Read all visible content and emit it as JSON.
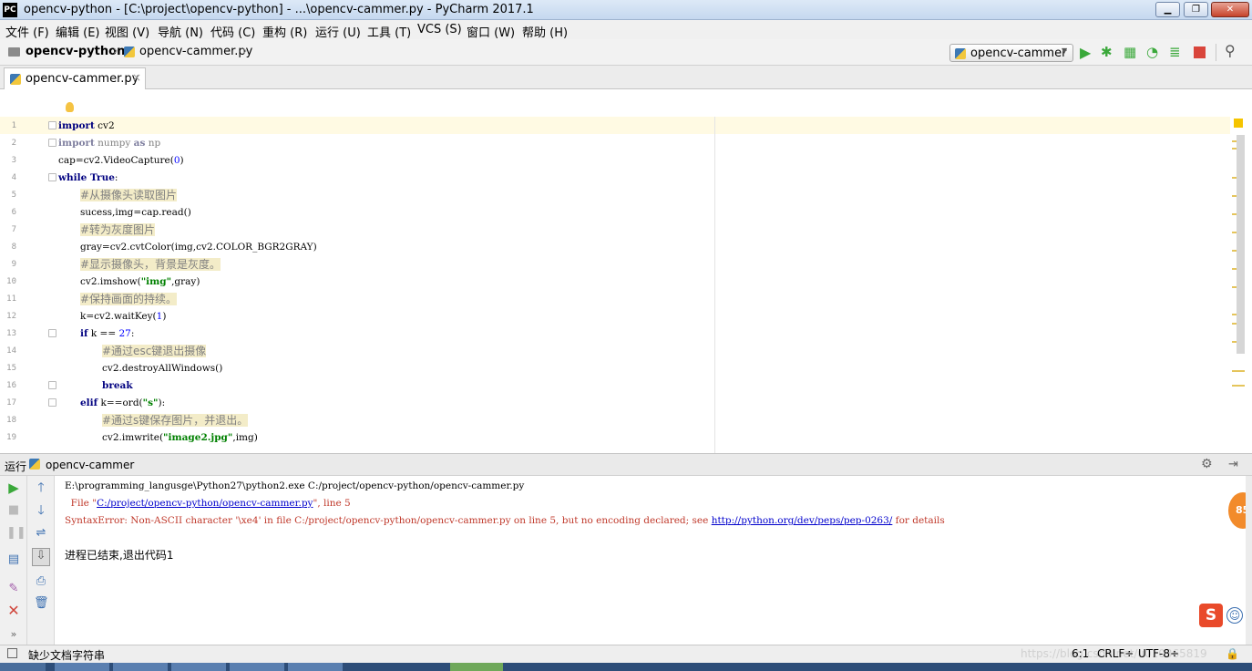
{
  "window": {
    "title": "opencv-python - [C:\\project\\opencv-python] - ...\\opencv-cammer.py - PyCharm 2017.1",
    "app_icon": "PC",
    "minimize": "▁",
    "maximize": "❐",
    "close": "✕"
  },
  "menu": [
    "文件 (F)",
    "编辑 (E)",
    "视图 (V)",
    "导航 (N)",
    "代码 (C)",
    "重构 (R)",
    "运行 (U)",
    "工具 (T)",
    "VCS (S)",
    "窗口 (W)",
    "帮助 (H)"
  ],
  "nav": {
    "project": "opencv-python",
    "file": "opencv-cammer.py",
    "run_config": "opencv-cammer"
  },
  "tab": {
    "label": "opencv-cammer.py",
    "close": "×"
  },
  "editor": {
    "line_numbers": [
      "1",
      "2",
      "3",
      "4",
      "5",
      "6",
      "7",
      "8",
      "9",
      "10",
      "11",
      "12",
      "13",
      "14",
      "15",
      "16",
      "17",
      "18",
      "19"
    ],
    "lines": {
      "l1_kw": "import",
      "l1_rest": " cv2",
      "l2_kw": "import",
      "l2_rest": " numpy ",
      "l2_as": "as",
      "l2_np": " np",
      "l3_a": "cap=cv2.VideoCapture(",
      "l3_num": "0",
      "l3_b": ")",
      "l4_kw": "while",
      "l4_true": " True",
      "l4_colon": ":",
      "l5_comment": "#从摄像头读取图片",
      "l6": "sucess,img=cap.read()",
      "l7_comment": "#转为灰度图片",
      "l8": "gray=cv2.cvtColor(img,cv2.COLOR_BGR2GRAY)",
      "l9_comment": "#显示摄像头，背景是灰度。",
      "l10_a": "cv2.imshow(",
      "l10_str": "\"img\"",
      "l10_b": ",gray)",
      "l11_comment": "#保持画面的持续。",
      "l12_a": "k=cv2.waitKey(",
      "l12_num": "1",
      "l12_b": ")",
      "l13_kw": "if",
      "l13_a": " k == ",
      "l13_num": "27",
      "l13_b": ":",
      "l14_comment": "#通过esc键退出摄像",
      "l15": "cv2.destroyAllWindows()",
      "l16_kw": "break",
      "l17_kw": "elif",
      "l17_a": " k==ord(",
      "l17_str": "\"s\"",
      "l17_b": "):",
      "l18_comment": "#通过s键保存图片，并退出。",
      "l19_a": "cv2.imwrite(",
      "l19_str": "\"image2.jpg\"",
      "l19_b": ",img)"
    }
  },
  "run_panel": {
    "label": "运行",
    "config": "opencv-cammer",
    "output": {
      "cmd": "E:\\programming_langusge\\Python27\\python2.exe C:/project/opencv-python/opencv-cammer.py",
      "file_prefix": "  File \"",
      "file_link": "C:/project/opencv-python/opencv-cammer.py",
      "file_suffix": "\", line 5",
      "error_text": "SyntaxError: Non-ASCII character '\\xe4' in file C:/project/opencv-python/opencv-cammer.py on line 5, but no encoding declared; see ",
      "error_link": "http://python.org/dev/peps/pep-0263/",
      "error_suffix": " for details",
      "exit": "进程已结束,退出代码1"
    },
    "badge": "85"
  },
  "statusbar": {
    "message": "缺少文档字符串",
    "position": "6:1",
    "line_sep": "CRLF÷",
    "encoding": "UTF-8÷",
    "watermark": "https://blog.csdn.net/u010365819"
  },
  "colors": {
    "keyword": "#000080",
    "string": "#008000",
    "number": "#0000ff",
    "error": "#c0392b",
    "link": "#0000cc"
  }
}
